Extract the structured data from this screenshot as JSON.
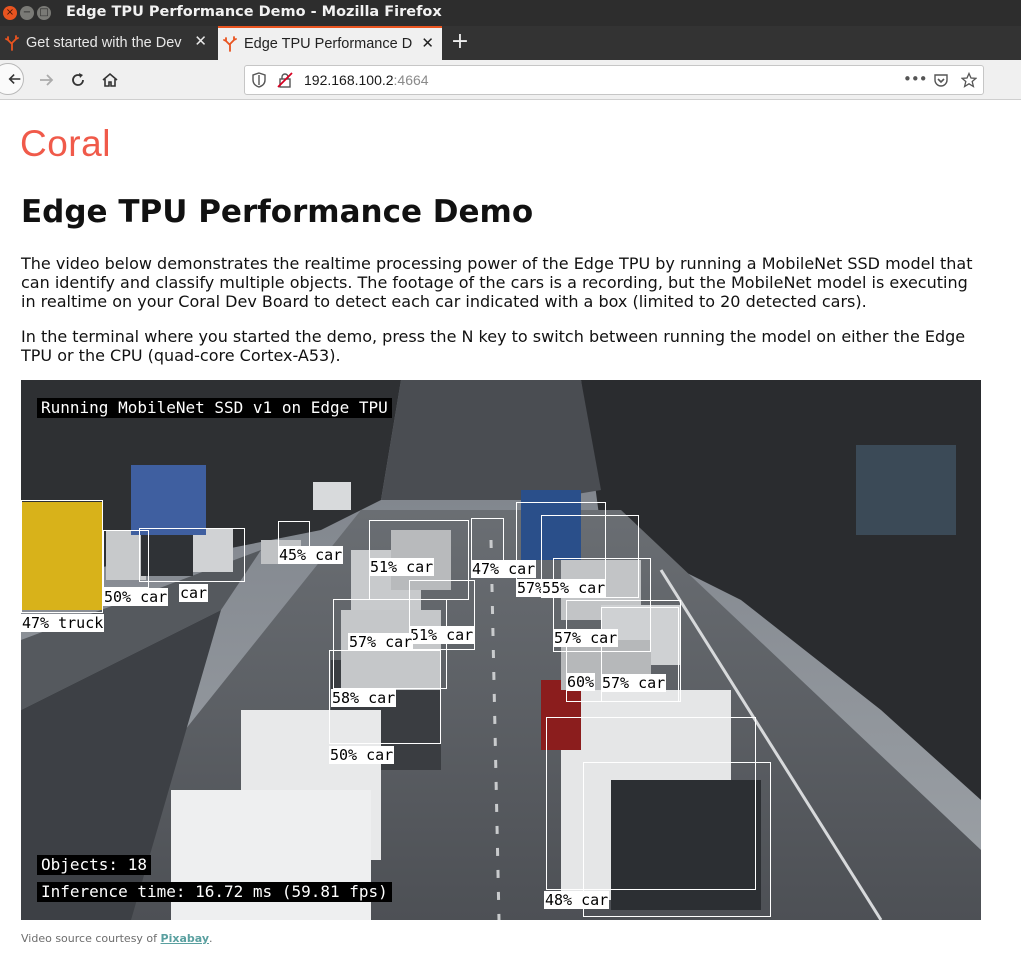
{
  "window": {
    "title": "Edge TPU Performance Demo - Mozilla Firefox",
    "close_glyph": "×",
    "min_glyph": "−",
    "max_glyph": "□"
  },
  "tabs": [
    {
      "label": "Get started with the Dev",
      "icon": "coral-favicon-icon",
      "close": "✕"
    },
    {
      "label": "Edge TPU Performance D",
      "icon": "coral-favicon-icon",
      "close": "✕"
    }
  ],
  "new_tab_glyph": "+",
  "nav": {
    "url_host": "192.168.100.2",
    "url_port": ":4664",
    "menu_glyph": "•••"
  },
  "page": {
    "logo": "Coral",
    "title": "Edge TPU Performance Demo",
    "paragraph1": "The video below demonstrates the realtime processing power of the Edge TPU by running a MobileNet SSD model that can identify and classify multiple objects. The footage of the cars is a recording, but the MobileNet model is executing in realtime on your Coral Dev Board to detect each car indicated with a box (limited to 20 detected cars).",
    "paragraph2": "In the terminal where you started the demo, press the N key to switch between running the model on either the Edge TPU or the CPU (quad-core Cortex-A53).",
    "credit_prefix": "Video source courtesy of ",
    "credit_link": "Pixabay",
    "credit_suffix": "."
  },
  "video": {
    "model_label": "Running MobileNet SSD v1 on Edge TPU",
    "objects_label": "Objects: 18",
    "inference_label": "Inference time: 16.72 ms (59.81 fps)",
    "detections": [
      {
        "label": "47% truck"
      },
      {
        "label": "50% car"
      },
      {
        "label": "car"
      },
      {
        "label": "45% car"
      },
      {
        "label": "51% car"
      },
      {
        "label": "47% car"
      },
      {
        "label": "57%"
      },
      {
        "label": "55% car"
      },
      {
        "label": "57% car"
      },
      {
        "label": "51% car"
      },
      {
        "label": "57% car"
      },
      {
        "label": "58% car"
      },
      {
        "label": "60%"
      },
      {
        "label": "57% car"
      },
      {
        "label": "50% car"
      },
      {
        "label": "48% car"
      }
    ]
  },
  "colors": {
    "accent": "#e95420",
    "logo": "#f05a4a",
    "link": "#5aa0a0"
  }
}
